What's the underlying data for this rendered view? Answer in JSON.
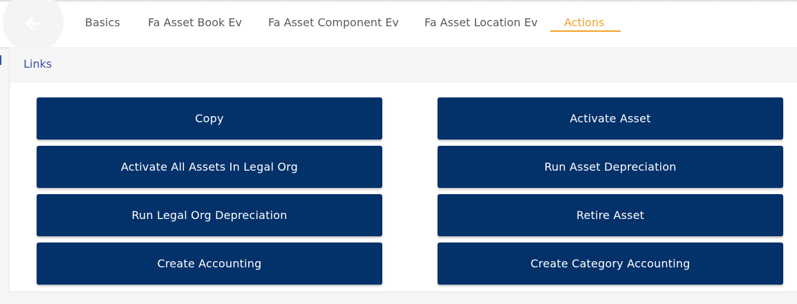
{
  "tabs": [
    {
      "label": "Basics"
    },
    {
      "label": "Fa Asset Book Ev"
    },
    {
      "label": "Fa Asset Component Ev"
    },
    {
      "label": "Fa Asset Location Ev"
    },
    {
      "label": "Actions",
      "active": true
    }
  ],
  "section": {
    "title": "Links"
  },
  "actions": {
    "left": [
      "Copy",
      "Activate All Assets In Legal Org",
      "Run Legal Org Depreciation",
      "Create Accounting"
    ],
    "right": [
      "Activate Asset",
      "Run Asset Depreciation",
      "Retire Asset",
      "Create Category Accounting"
    ]
  },
  "colors": {
    "accent": "#f0a12b",
    "button_bg": "#03316a",
    "link": "#3d4fa3"
  },
  "icons": {
    "back": "arrow-left-icon"
  }
}
